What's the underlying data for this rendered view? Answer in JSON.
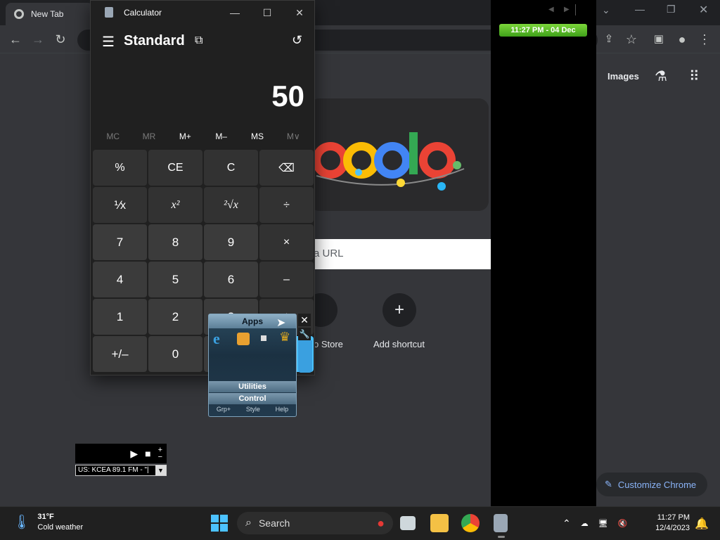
{
  "browser": {
    "tab_title": "New Tab",
    "new_tab_symbol": "+",
    "customize_label": "Customize Chrome",
    "images_link": "Images",
    "search_placeholder": "a URL",
    "shortcut_store_label": "o Store",
    "add_shortcut_label": "Add shortcut",
    "add_shortcut_symbol": "+"
  },
  "clock_gadget": {
    "text": "11:27 PM - 04 Dec"
  },
  "calculator": {
    "title": "Calculator",
    "mode": "Standard",
    "display": "50",
    "memory": [
      "MC",
      "MR",
      "M+",
      "M–",
      "MS",
      "M∨"
    ],
    "keys": [
      "%",
      "CE",
      "C",
      "⌫",
      "⅟x",
      "x²",
      "²√x",
      "÷",
      "7",
      "8",
      "9",
      "×",
      "4",
      "5",
      "6",
      "–",
      "1",
      "2",
      "3",
      "+",
      "+/–",
      "0",
      ".",
      "="
    ]
  },
  "apps_gadget": {
    "header": "Apps",
    "utilities": "Utilities",
    "control": "Control",
    "footer": [
      "Grp+",
      "Style",
      "Help"
    ]
  },
  "radio": {
    "station": "US: KCEA 89.1 FM - \"|"
  },
  "taskbar": {
    "temperature": "31°F",
    "weather": "Cold weather",
    "search_label": "Search",
    "time": "11:27 PM",
    "date": "12/4/2023"
  },
  "colors": {
    "accent": "#8ab4f8",
    "gadget_green": "#5bbf2a"
  }
}
